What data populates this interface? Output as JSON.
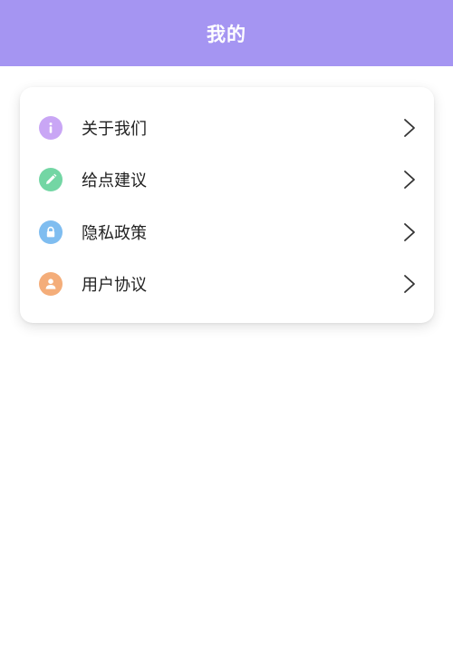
{
  "header": {
    "title": "我的",
    "background": "#a595f2"
  },
  "menu": {
    "items": [
      {
        "label": "关于我们",
        "icon": "info-icon",
        "color": "#c9a6f5"
      },
      {
        "label": "给点建议",
        "icon": "pencil-icon",
        "color": "#73d6a4"
      },
      {
        "label": "隐私政策",
        "icon": "lock-icon",
        "color": "#7fbdf0"
      },
      {
        "label": "用户协议",
        "icon": "user-icon",
        "color": "#f4ad79"
      }
    ]
  }
}
